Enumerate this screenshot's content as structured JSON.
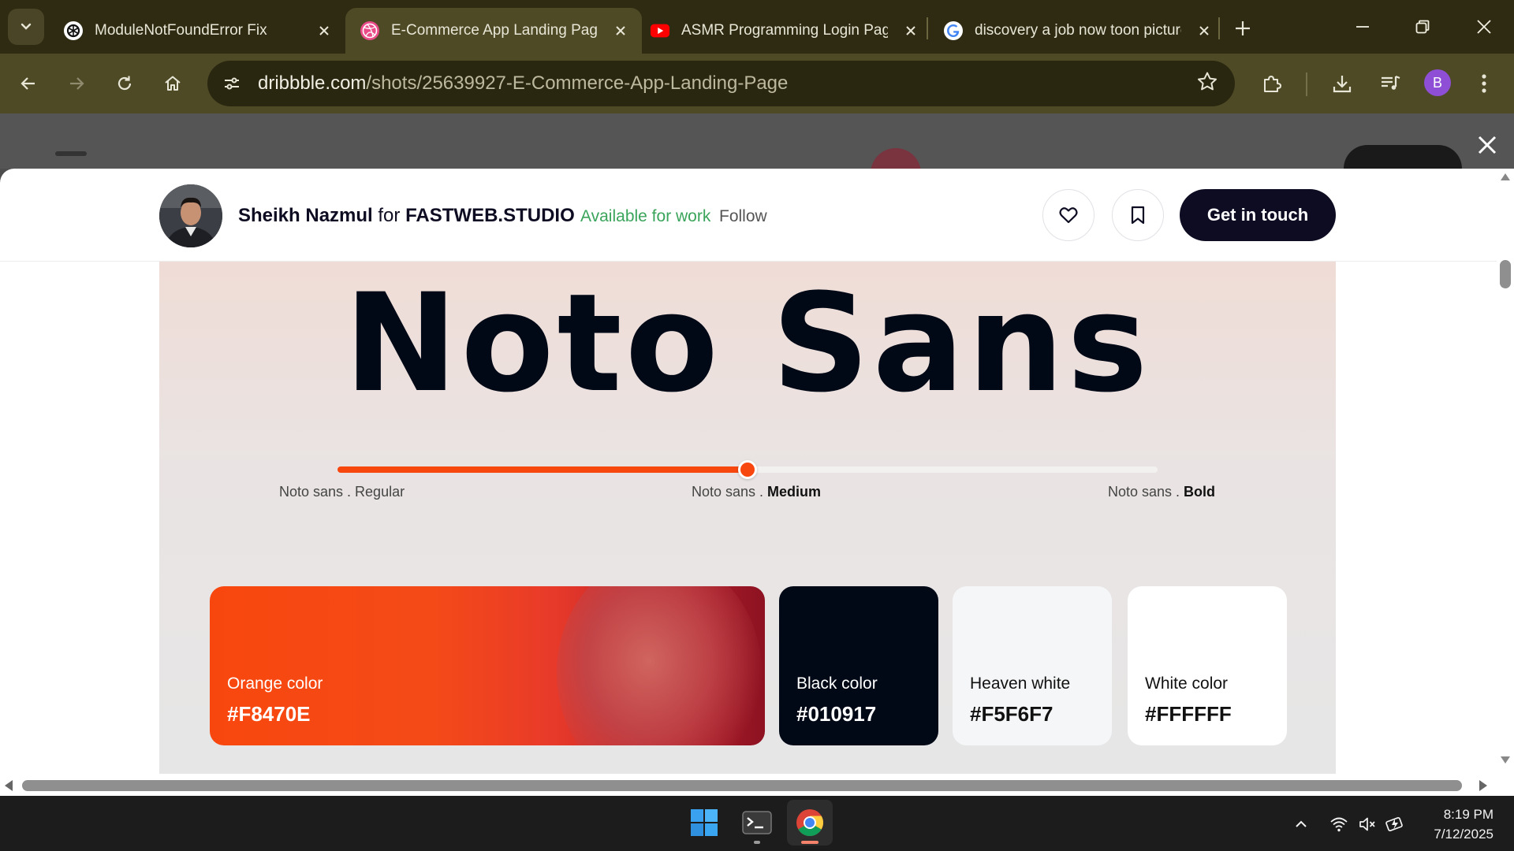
{
  "tabs": [
    {
      "title": "ModuleNotFoundError Fix",
      "icon": "chatgpt-icon",
      "active": false
    },
    {
      "title": "E-Commerce App Landing Page",
      "icon": "dribbble-icon",
      "active": true
    },
    {
      "title": "ASMR Programming Login Page",
      "icon": "youtube-icon",
      "active": false
    },
    {
      "title": "discovery a job now toon picture",
      "icon": "google-icon",
      "active": false
    }
  ],
  "address_bar": {
    "host": "dribbble.com",
    "path": "/shots/25639927-E-Commerce-App-Landing-Page"
  },
  "profile_initial": "B",
  "shot": {
    "author_name": "Sheikh Nazmul",
    "for_word": "for",
    "studio": "FASTWEB.STUDIO",
    "available": "Available for work",
    "follow": "Follow",
    "cta": "Get in touch"
  },
  "artwork": {
    "font_name": "Noto Sans",
    "slider_value_percent": 50,
    "weights": [
      {
        "prefix": "Noto sans . ",
        "weight": "Regular"
      },
      {
        "prefix": "Noto sans . ",
        "weight": "Medium"
      },
      {
        "prefix": "Noto sans . ",
        "weight": "Bold"
      }
    ],
    "swatches": [
      {
        "label": "Orange color",
        "hex": "#F8470E"
      },
      {
        "label": "Black color",
        "hex": "#010917"
      },
      {
        "label": "Heaven white",
        "hex": "#F5F6F7"
      },
      {
        "label": "White color",
        "hex": "#FFFFFF"
      }
    ]
  },
  "colors": {
    "accent": "#F8470E",
    "dark": "#010917",
    "available_green": "#3AA45B",
    "chrome_frame": "#2F2B12",
    "chrome_toolbar": "#4E4A26"
  },
  "taskbar": {
    "time": "8:19 PM",
    "date": "7/12/2025"
  }
}
